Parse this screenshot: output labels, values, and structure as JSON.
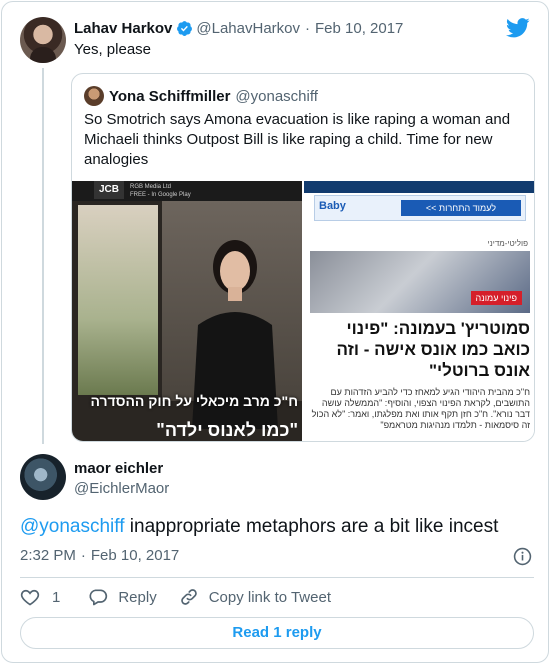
{
  "tweet": {
    "author_name": "Lahav Harkov",
    "author_handle": "@LahavHarkov",
    "separator": "·",
    "date": "Feb 10, 2017",
    "text": "Yes, please"
  },
  "quoted_tweet": {
    "author_name": "Yona Schiffmiller",
    "author_handle": "@yonaschiff",
    "text": "So Smotrich says Amona evacuation is like raping a woman and Michaeli thinks Outpost Bill is like raping a child. Time for new analogies",
    "media_left": {
      "app_name": "RGB Media Ltd",
      "app_sub": "FREE - In Google Play",
      "caption_line1": "ח\"כ מרב מיכאלי על חוק ההסדרה",
      "caption_line2": "\"כמו לאנוס ילדה\""
    },
    "media_right": {
      "ad_brand": "Baby",
      "ad_button": "לעמוד התחרות >>",
      "section": "פוליטי-מדיני",
      "photo_tag": "פינוי עמונה",
      "headline": "סמוטריץ' בעמונה: \"פינוי כואב כמו אונס אישה - וזה אונס ברוטלי\"",
      "body": "ח\"כ מהבית היהודי הגיע למאחז כדי להביע הזדהות עם התושבים, לקראת הפינוי הצפוי, והוסיף: \"הממשלה עושה דבר נורא\". ח\"כ חזן תקף אותו ואת מפלגתו, ואמר: \"לא הכול זה סיסמאות - תלמדו מנהיגות מטראמפ\""
    }
  },
  "reply": {
    "author_name": "maor eichler",
    "author_handle": "@EichlerMaor",
    "mention": "@yonaschiff",
    "text": " inappropriate metaphors are a bit like incest",
    "time": "2:32 PM",
    "date": "Feb 10, 2017",
    "separator": "·"
  },
  "actions": {
    "like_count": "1",
    "reply_label": "Reply",
    "copy_link_label": "Copy link to Tweet"
  },
  "read_reply_label": "Read 1 reply",
  "colors": {
    "accent": "#1d9bf0",
    "text": "#0f1419",
    "muted": "#536471",
    "border": "#cfd9de"
  },
  "icons": [
    "twitter-bird-icon",
    "verified-badge-icon",
    "info-icon",
    "heart-icon",
    "reply-icon",
    "link-icon"
  ]
}
